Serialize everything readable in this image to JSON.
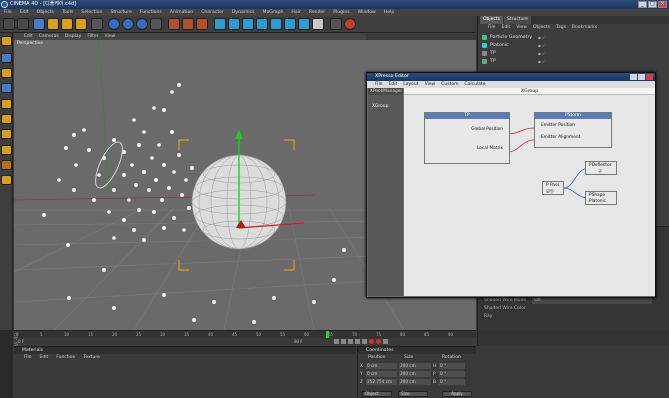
{
  "app": {
    "title": "CINEMA 4D - [디폴케이.c4d]",
    "menu": [
      "File",
      "Edit",
      "Objects",
      "Tools",
      "Selection",
      "Structure",
      "Functions",
      "Animation",
      "Character",
      "Dynamics",
      "MoGraph",
      "Hair",
      "Render",
      "Plugins",
      "Window",
      "Help"
    ]
  },
  "viewport": {
    "menu": [
      "Edit",
      "Cameras",
      "Display",
      "Filter",
      "View"
    ],
    "label": "Perspective"
  },
  "object_manager": {
    "tabs": [
      "Objects",
      "Structure"
    ],
    "menu": [
      "File",
      "Edit",
      "View",
      "Objects",
      "Tags",
      "Bookmarks"
    ],
    "objects": [
      {
        "name": "Particle Geometry",
        "icon": "particle-geometry-icon"
      },
      {
        "name": "Platonic",
        "icon": "platonic-icon"
      },
      {
        "name": "TP",
        "icon": "null-icon"
      },
      {
        "name": "TP",
        "icon": "thinking-particles-icon"
      }
    ]
  },
  "attributes": {
    "rows": [
      {
        "label": "Shaded Wire Mode",
        "value": "Off"
      },
      {
        "label": "Shaded Wire Color",
        "value": ""
      },
      {
        "label": "Ray",
        "value": ""
      }
    ]
  },
  "xpresso": {
    "title": "XPresso Editor",
    "menu": [
      "File",
      "Edit",
      "Layout",
      "View",
      "Custom",
      "Calculate"
    ],
    "pool_header": "XPool/Manager",
    "pool_item": "XGroup",
    "canvas_title": "XGroup",
    "nodes": {
      "tp": {
        "title": "TP",
        "ports": [
          "Global Position",
          "Local Matrix"
        ]
      },
      "pstorm": {
        "title": "PStorm",
        "ports": [
          "Emitter Position",
          "Emitter Alignment"
        ]
      },
      "ppass": {
        "title": "P Pass",
        "sub": "모두"
      },
      "pdeflector": {
        "title": "PDeflector",
        "sub": "구"
      },
      "pshape": {
        "title": "PShape",
        "sub": "Platonic"
      }
    }
  },
  "timeline": {
    "ticks": [
      "0",
      "5",
      "10",
      "15",
      "20",
      "25",
      "30",
      "35",
      "40",
      "45",
      "50",
      "55",
      "60",
      "65",
      "70",
      "75",
      "80",
      "85",
      "90"
    ],
    "current_frame": "90 F",
    "start": "0 F"
  },
  "materials": {
    "title": "Materials",
    "menu": [
      "File",
      "Edit",
      "Function",
      "Texture"
    ]
  },
  "coordinates": {
    "title": "Coordinates",
    "headers": [
      "Position",
      "Size",
      "Rotation"
    ],
    "rows": [
      {
        "axis": "X",
        "pos": "0 cm",
        "size": "200 cm",
        "rot_axis": "H",
        "rot": "0 °"
      },
      {
        "axis": "Y",
        "pos": "0 cm",
        "size": "200 cm",
        "rot_axis": "P",
        "rot": "0 °"
      },
      {
        "axis": "Z",
        "pos": "252.754 cm",
        "size": "200 cm",
        "rot_axis": "B",
        "rot": "0 °"
      }
    ],
    "mode": "Object",
    "size_mode": "Size",
    "apply": "Apply"
  },
  "side_label": "CINEMA 4D",
  "colors": {
    "titlebar": "#1d3660",
    "axis_y": "#22cc22",
    "axis_x": "#cc2222",
    "gizmo_bracket": "#e39a1a",
    "node_header": "#5a7bb8",
    "wire": "#c03030"
  }
}
